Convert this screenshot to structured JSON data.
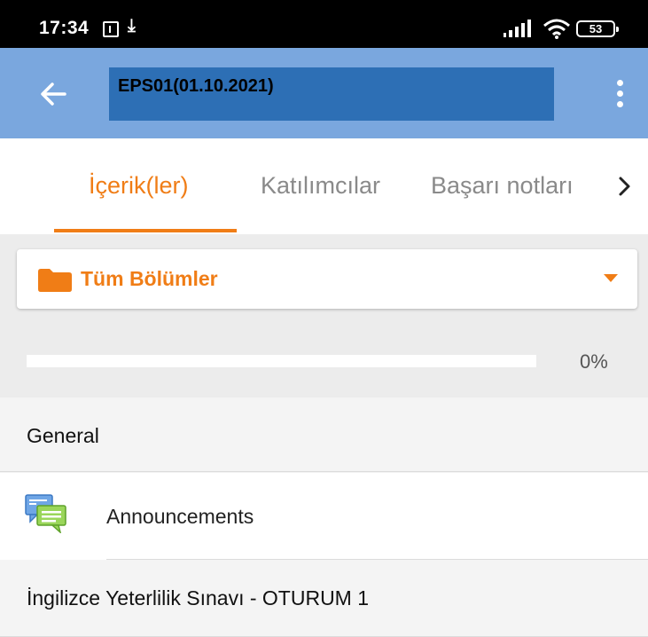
{
  "status_bar": {
    "time": "17:34",
    "battery": "53"
  },
  "app_bar": {
    "title": "EPS01(01.10.2021)"
  },
  "tabs": [
    {
      "label": "İçerik(ler)",
      "active": true
    },
    {
      "label": "Katılımcılar",
      "active": false
    },
    {
      "label": "Başarı notları",
      "active": false
    }
  ],
  "section_selector": {
    "label": "Tüm Bölümler",
    "icon": "folder-icon"
  },
  "progress": {
    "value": 0,
    "text": "0%"
  },
  "sections": [
    {
      "title": "General"
    },
    {
      "title": "İngilizce Yeterlilik Sınavı - OTURUM 1"
    }
  ],
  "modules": [
    {
      "name": "Announcements",
      "icon": "forum-icon"
    }
  ],
  "colors": {
    "accent": "#f07d16",
    "app_bar": "#7aa7de",
    "title_highlight": "#2d6fb5"
  }
}
